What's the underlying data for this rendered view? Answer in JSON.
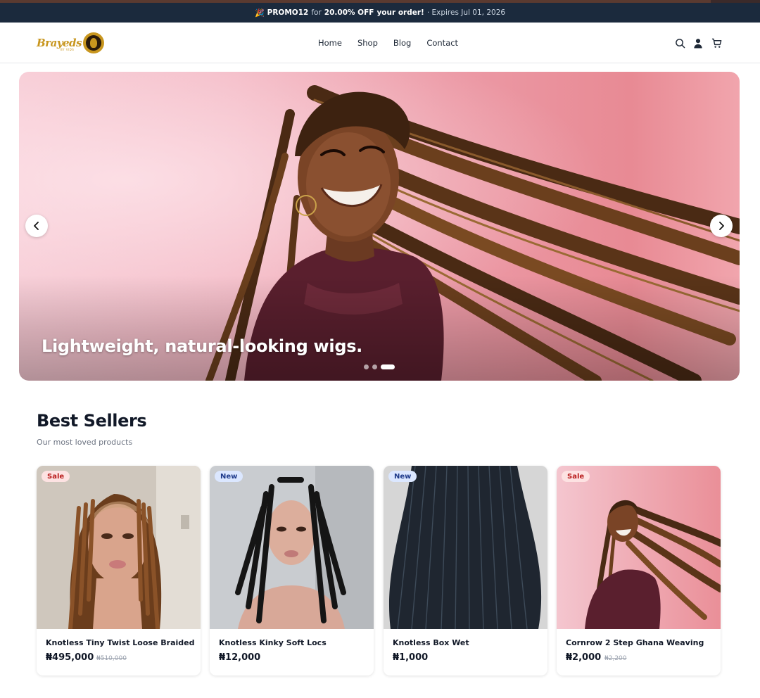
{
  "promo": {
    "emoji": "🎉",
    "code": "PROMO12",
    "for_text": "for",
    "discount": "20.00% OFF",
    "tail": "your order!",
    "expires": "· Expires Jul 01, 2026"
  },
  "header": {
    "logo_text": "Brayeds",
    "logo_sub": "BY VIDS",
    "nav": [
      "Home",
      "Shop",
      "Blog",
      "Contact"
    ],
    "icons": [
      "search-icon",
      "user-icon",
      "cart-icon"
    ]
  },
  "hero": {
    "caption": "Lightweight, natural-looking wigs.",
    "slide_count": 3,
    "active_slide": 3,
    "prev_icon": "chevron-left-icon",
    "next_icon": "chevron-right-icon"
  },
  "best_sellers": {
    "title": "Best Sellers",
    "subtitle": "Our most loved products",
    "products": [
      {
        "badge": "Sale",
        "name": "Knotless Tiny Twist Loose Braided",
        "price": "₦495,000",
        "old_price": "₦510,000"
      },
      {
        "badge": "New",
        "name": "Knotless Kinky Soft Locs",
        "price": "₦12,000",
        "old_price": ""
      },
      {
        "badge": "New",
        "name": "Knotless Box Wet",
        "price": "₦1,000",
        "old_price": ""
      },
      {
        "badge": "Sale",
        "name": "Cornrow 2 Step Ghana Weaving",
        "price": "₦2,000",
        "old_price": "₦2,200"
      }
    ]
  },
  "colors": {
    "promo_bg": "#1b2a3d",
    "brand_gold": "#c8961e",
    "sale_badge": "#fde2e2",
    "new_badge": "#dbe7ff"
  }
}
